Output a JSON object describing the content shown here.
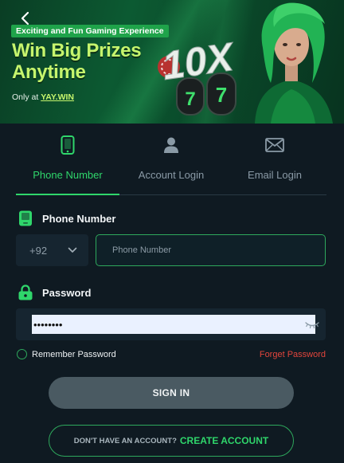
{
  "banner": {
    "tagline": "Exciting and Fun Gaming Experience",
    "headline_line1": "Win Big Prizes",
    "headline_line2": "Anytime",
    "only_at": "Only at",
    "brand": "YAY.WIN",
    "promo_text": "10X"
  },
  "tabs": [
    {
      "label": "Phone Number",
      "icon": "phone-icon",
      "active": true
    },
    {
      "label": "Account Login",
      "icon": "user-icon",
      "active": false
    },
    {
      "label": "Email Login",
      "icon": "mail-icon",
      "active": false
    }
  ],
  "phone": {
    "label": "Phone Number",
    "country_code": "+92",
    "placeholder": "Phone Number",
    "value": ""
  },
  "password": {
    "label": "Password",
    "value": "••••••••"
  },
  "remember_label": "Remember Password",
  "forgot_label": "Forget Password",
  "sign_in_label": "SIGN IN",
  "create": {
    "question": "DON'T HAVE AN ACCOUNT?",
    "cta": "CREATE ACCOUNT"
  },
  "colors": {
    "background": "#0f1a22",
    "accent": "#2fd66b",
    "danger": "#e2453c",
    "button": "#4a5a62"
  }
}
